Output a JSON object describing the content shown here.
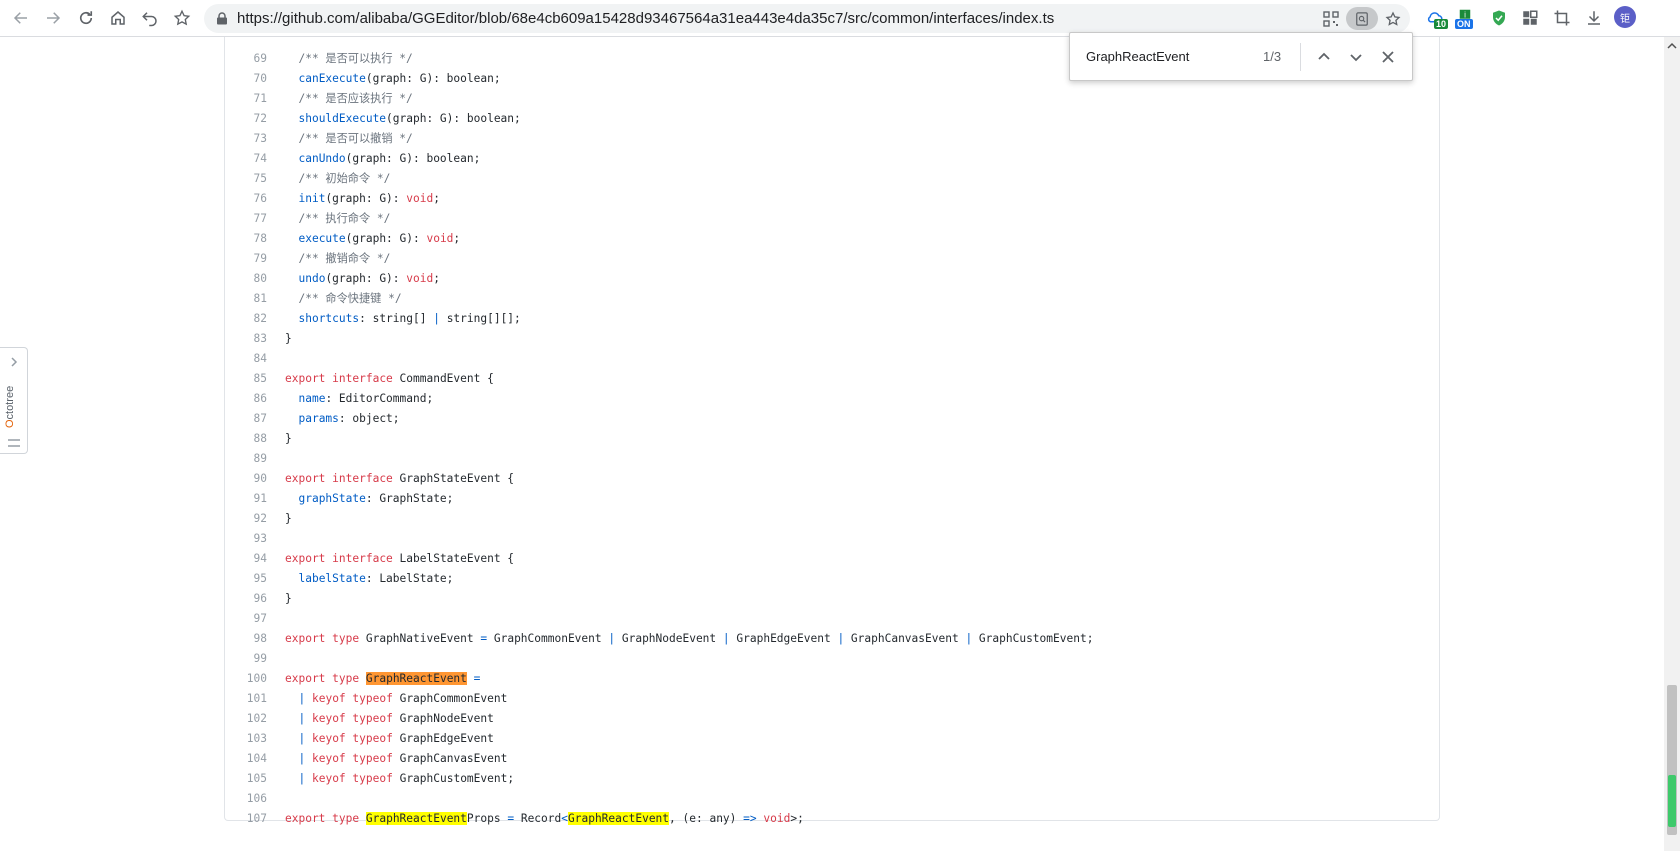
{
  "browser": {
    "url": "https://github.com/alibaba/GGEditor/blob/68e4cb609a15428d93467564a31ea443e4da35c7/src/common/interfaces/index.ts",
    "extensions": [
      {
        "name": "weather-extension",
        "badge": "10",
        "badge_color": "#1a8a3a"
      },
      {
        "name": "toggle-extension",
        "badge": "ON",
        "badge_color": "#1a73e8"
      },
      {
        "name": "shield-extension",
        "badge": ""
      },
      {
        "name": "grid-extension",
        "badge": ""
      },
      {
        "name": "crop-extension",
        "badge": ""
      },
      {
        "name": "download-extension",
        "badge": ""
      }
    ],
    "avatar_text": "钜"
  },
  "find": {
    "query": "GraphReactEvent",
    "count": "1/3"
  },
  "octotree": {
    "label_first": "O",
    "label_rest": "ctotree"
  },
  "code": {
    "highlight_color": "#ffff00",
    "current_highlight_color": "#ff9632",
    "lines": [
      {
        "n": "69",
        "tokens": [
          [
            "c",
            "  /** 是否可以执行 */"
          ]
        ]
      },
      {
        "n": "70",
        "tokens": [
          [
            "t",
            "  "
          ],
          [
            "f",
            "canExecute"
          ],
          [
            "t",
            "(graph: G): boolean;"
          ]
        ]
      },
      {
        "n": "71",
        "tokens": [
          [
            "c",
            "  /** 是否应该执行 */"
          ]
        ]
      },
      {
        "n": "72",
        "tokens": [
          [
            "t",
            "  "
          ],
          [
            "f",
            "shouldExecute"
          ],
          [
            "t",
            "(graph: G): boolean;"
          ]
        ]
      },
      {
        "n": "73",
        "tokens": [
          [
            "c",
            "  /** 是否可以撤销 */"
          ]
        ]
      },
      {
        "n": "74",
        "tokens": [
          [
            "t",
            "  "
          ],
          [
            "f",
            "canUndo"
          ],
          [
            "t",
            "(graph: G): boolean;"
          ]
        ]
      },
      {
        "n": "75",
        "tokens": [
          [
            "c",
            "  /** 初始命令 */"
          ]
        ]
      },
      {
        "n": "76",
        "tokens": [
          [
            "t",
            "  "
          ],
          [
            "f",
            "init"
          ],
          [
            "t",
            "(graph: G): "
          ],
          [
            "k",
            "void"
          ],
          [
            "t",
            ";"
          ]
        ]
      },
      {
        "n": "77",
        "tokens": [
          [
            "c",
            "  /** 执行命令 */"
          ]
        ]
      },
      {
        "n": "78",
        "tokens": [
          [
            "t",
            "  "
          ],
          [
            "f",
            "execute"
          ],
          [
            "t",
            "(graph: G): "
          ],
          [
            "k",
            "void"
          ],
          [
            "t",
            ";"
          ]
        ]
      },
      {
        "n": "79",
        "tokens": [
          [
            "c",
            "  /** 撤销命令 */"
          ]
        ]
      },
      {
        "n": "80",
        "tokens": [
          [
            "t",
            "  "
          ],
          [
            "f",
            "undo"
          ],
          [
            "t",
            "(graph: G): "
          ],
          [
            "k",
            "void"
          ],
          [
            "t",
            ";"
          ]
        ]
      },
      {
        "n": "81",
        "tokens": [
          [
            "c",
            "  /** 命令快捷键 */"
          ]
        ]
      },
      {
        "n": "82",
        "tokens": [
          [
            "t",
            "  "
          ],
          [
            "f",
            "shortcuts"
          ],
          [
            "t",
            ": string[] "
          ],
          [
            "o",
            "|"
          ],
          [
            "t",
            " string[][];"
          ]
        ]
      },
      {
        "n": "83",
        "tokens": [
          [
            "t",
            "}"
          ]
        ]
      },
      {
        "n": "84",
        "tokens": []
      },
      {
        "n": "85",
        "tokens": [
          [
            "k",
            "export"
          ],
          [
            "t",
            " "
          ],
          [
            "k",
            "interface"
          ],
          [
            "t",
            " CommandEvent {"
          ]
        ]
      },
      {
        "n": "86",
        "tokens": [
          [
            "t",
            "  "
          ],
          [
            "f",
            "name"
          ],
          [
            "t",
            ": EditorCommand;"
          ]
        ]
      },
      {
        "n": "87",
        "tokens": [
          [
            "t",
            "  "
          ],
          [
            "f",
            "params"
          ],
          [
            "t",
            ": object;"
          ]
        ]
      },
      {
        "n": "88",
        "tokens": [
          [
            "t",
            "}"
          ]
        ]
      },
      {
        "n": "89",
        "tokens": []
      },
      {
        "n": "90",
        "tokens": [
          [
            "k",
            "export"
          ],
          [
            "t",
            " "
          ],
          [
            "k",
            "interface"
          ],
          [
            "t",
            " GraphStateEvent {"
          ]
        ]
      },
      {
        "n": "91",
        "tokens": [
          [
            "t",
            "  "
          ],
          [
            "f",
            "graphState"
          ],
          [
            "t",
            ": GraphState;"
          ]
        ]
      },
      {
        "n": "92",
        "tokens": [
          [
            "t",
            "}"
          ]
        ]
      },
      {
        "n": "93",
        "tokens": []
      },
      {
        "n": "94",
        "tokens": [
          [
            "k",
            "export"
          ],
          [
            "t",
            " "
          ],
          [
            "k",
            "interface"
          ],
          [
            "t",
            " LabelStateEvent {"
          ]
        ]
      },
      {
        "n": "95",
        "tokens": [
          [
            "t",
            "  "
          ],
          [
            "f",
            "labelState"
          ],
          [
            "t",
            ": LabelState;"
          ]
        ]
      },
      {
        "n": "96",
        "tokens": [
          [
            "t",
            "}"
          ]
        ]
      },
      {
        "n": "97",
        "tokens": []
      },
      {
        "n": "98",
        "tokens": [
          [
            "k",
            "export"
          ],
          [
            "t",
            " "
          ],
          [
            "k",
            "type"
          ],
          [
            "t",
            " GraphNativeEvent "
          ],
          [
            "o",
            "="
          ],
          [
            "t",
            " GraphCommonEvent "
          ],
          [
            "o",
            "|"
          ],
          [
            "t",
            " GraphNodeEvent "
          ],
          [
            "o",
            "|"
          ],
          [
            "t",
            " GraphEdgeEvent "
          ],
          [
            "o",
            "|"
          ],
          [
            "t",
            " GraphCanvasEvent "
          ],
          [
            "o",
            "|"
          ],
          [
            "t",
            " GraphCustomEvent;"
          ]
        ]
      },
      {
        "n": "99",
        "tokens": []
      },
      {
        "n": "100",
        "tokens": [
          [
            "k",
            "export"
          ],
          [
            "t",
            " "
          ],
          [
            "k",
            "type"
          ],
          [
            "t",
            " "
          ],
          [
            "hc",
            "GraphReactEvent"
          ],
          [
            "t",
            " "
          ],
          [
            "o",
            "="
          ]
        ]
      },
      {
        "n": "101",
        "tokens": [
          [
            "t",
            "  "
          ],
          [
            "o",
            "|"
          ],
          [
            "t",
            " "
          ],
          [
            "k",
            "keyof"
          ],
          [
            "t",
            " "
          ],
          [
            "k",
            "typeof"
          ],
          [
            "t",
            " GraphCommonEvent"
          ]
        ]
      },
      {
        "n": "102",
        "tokens": [
          [
            "t",
            "  "
          ],
          [
            "o",
            "|"
          ],
          [
            "t",
            " "
          ],
          [
            "k",
            "keyof"
          ],
          [
            "t",
            " "
          ],
          [
            "k",
            "typeof"
          ],
          [
            "t",
            " GraphNodeEvent"
          ]
        ]
      },
      {
        "n": "103",
        "tokens": [
          [
            "t",
            "  "
          ],
          [
            "o",
            "|"
          ],
          [
            "t",
            " "
          ],
          [
            "k",
            "keyof"
          ],
          [
            "t",
            " "
          ],
          [
            "k",
            "typeof"
          ],
          [
            "t",
            " GraphEdgeEvent"
          ]
        ]
      },
      {
        "n": "104",
        "tokens": [
          [
            "t",
            "  "
          ],
          [
            "o",
            "|"
          ],
          [
            "t",
            " "
          ],
          [
            "k",
            "keyof"
          ],
          [
            "t",
            " "
          ],
          [
            "k",
            "typeof"
          ],
          [
            "t",
            " GraphCanvasEvent"
          ]
        ]
      },
      {
        "n": "105",
        "tokens": [
          [
            "t",
            "  "
          ],
          [
            "o",
            "|"
          ],
          [
            "t",
            " "
          ],
          [
            "k",
            "keyof"
          ],
          [
            "t",
            " "
          ],
          [
            "k",
            "typeof"
          ],
          [
            "t",
            " GraphCustomEvent;"
          ]
        ]
      },
      {
        "n": "106",
        "tokens": []
      },
      {
        "n": "107",
        "tokens": [
          [
            "k",
            "export"
          ],
          [
            "t",
            " "
          ],
          [
            "k",
            "type"
          ],
          [
            "t",
            " "
          ],
          [
            "h",
            "GraphReactEvent"
          ],
          [
            "t",
            "Props "
          ],
          [
            "o",
            "="
          ],
          [
            "t",
            " Record"
          ],
          [
            "o",
            "<"
          ],
          [
            "h",
            "GraphReactEvent"
          ],
          [
            "t",
            ", (e: any) "
          ],
          [
            "o",
            "=>"
          ],
          [
            "t",
            " "
          ],
          [
            "k",
            "void"
          ],
          [
            "t",
            ">;"
          ]
        ]
      }
    ]
  }
}
